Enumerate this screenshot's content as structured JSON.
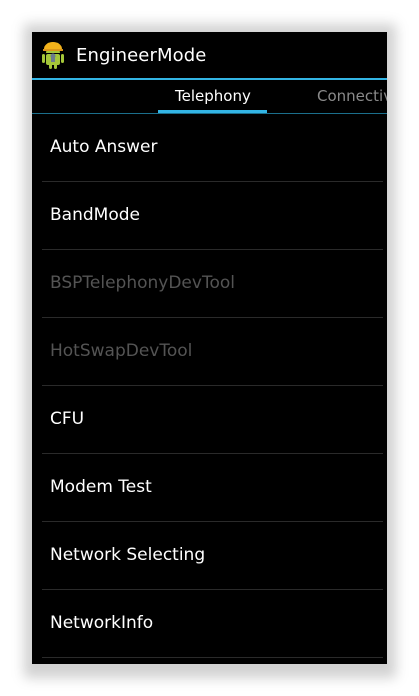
{
  "app": {
    "title": "EngineerMode",
    "icon": "android-icon"
  },
  "tabs": [
    {
      "label": "Telephony",
      "selected": true
    },
    {
      "label": "Connectiv",
      "selected": false
    }
  ],
  "items": [
    {
      "label": "Auto Answer",
      "enabled": true
    },
    {
      "label": "BandMode",
      "enabled": true
    },
    {
      "label": "BSPTelephonyDevTool",
      "enabled": false
    },
    {
      "label": "HotSwapDevTool",
      "enabled": false
    },
    {
      "label": "CFU",
      "enabled": true
    },
    {
      "label": "Modem Test",
      "enabled": true
    },
    {
      "label": "Network Selecting",
      "enabled": true
    },
    {
      "label": "NetworkInfo",
      "enabled": true
    }
  ],
  "colors": {
    "accent": "#33b5e5",
    "background": "#000000",
    "text": "#ffffff",
    "disabled_text": "#545454"
  }
}
